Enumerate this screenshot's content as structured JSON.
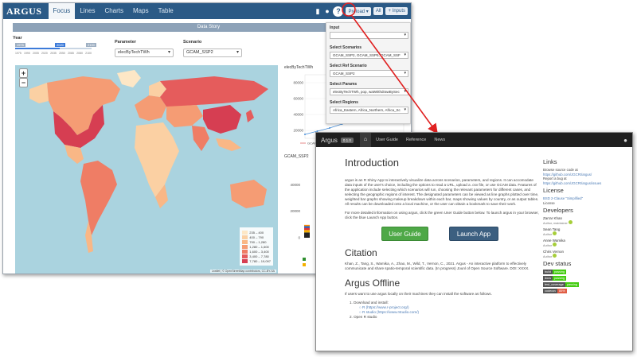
{
  "back_app": {
    "brand": "ARGUS",
    "tabs": [
      "Focus",
      "Lines",
      "Charts",
      "Maps",
      "Table"
    ],
    "active_tab": 0,
    "buttons": {
      "preload": "Preload ▾",
      "all": "All",
      "inputs": "+ Inputs"
    },
    "data_story": "Data Story",
    "year": {
      "label": "Year",
      "min": "1975",
      "current": "2020",
      "max": "2100",
      "ticks": [
        "1975",
        "1990",
        "2005",
        "2020",
        "2035",
        "2050",
        "2065",
        "2080",
        "2100"
      ]
    },
    "parameter": {
      "label": "Parameter",
      "value": "elecByTechTWh"
    },
    "scenario": {
      "label": "Scenario",
      "value": "GCAM_SSP2"
    },
    "map_legend": {
      "ranges": [
        "235 – 400",
        "400 – 790",
        "790 – 1,280",
        "1,280 – 1,600",
        "1,600 – 3,400",
        "3,400 – 7,780",
        "7,780 – 19,097"
      ],
      "colors": [
        "#fde7c6",
        "#fbd0a3",
        "#f9b786",
        "#f59c74",
        "#ef7d65",
        "#e55c5c",
        "#d63e52"
      ]
    },
    "map_attribution": "Leaflet | © OpenStreetMap contributors, CC-BY-SA",
    "zoom_in": "+",
    "zoom_out": "−",
    "line_chart_title": "elecByTechTWh",
    "bar_chart_title": "GCAM_SSP2",
    "legend_item": "GCAM",
    "input_panel": {
      "input_label": "Input",
      "scenarios_label": "Select Scenarios",
      "scenarios_value": "GCAM_SSP2, GCAM_SSP5, GCAM_SSF",
      "ref_label": "Select Ref Scenario",
      "ref_value": "GCAM_SSP2",
      "params_label": "Select Params",
      "params_value": "elecByTechTWh, pop, watWithdrawBySec",
      "regions_label": "Select Regions",
      "regions_value": "Africa_Eastern, Africa_Northern, Africa_Sc"
    }
  },
  "chart_data": [
    {
      "type": "line",
      "title": "elecByTechTWh",
      "y_ticks": [
        "80000",
        "60000",
        "40000",
        "20000"
      ],
      "ylim": [
        10000,
        90000
      ],
      "series": [
        {
          "name": "GCAM",
          "color": "#4a90d9",
          "x": [
            0,
            1,
            2,
            3,
            4,
            5,
            6,
            7,
            8
          ],
          "values": [
            15000,
            19000,
            23000,
            28000,
            33000,
            41000,
            49000,
            58000,
            66000
          ]
        },
        {
          "color": "#2f8f2f",
          "x": [
            4,
            5,
            6,
            7,
            8
          ],
          "values": [
            32000,
            38000,
            45000,
            53000,
            61000
          ]
        },
        {
          "color": "#e06b6b",
          "x": [
            5,
            6,
            7,
            8
          ],
          "values": [
            37000,
            43000,
            49000,
            55000
          ]
        }
      ]
    },
    {
      "type": "bar",
      "title": "GCAM_SSP2",
      "y_ticks": [
        "40000",
        "20000",
        "0"
      ],
      "ylim": [
        0,
        45000
      ],
      "categories": [
        "GCAM_SSP2"
      ],
      "stacks": [
        {
          "color": "#222222",
          "value": 4000
        },
        {
          "color": "#f4b000",
          "value": 1800
        },
        {
          "color": "#e03030",
          "value": 1600
        },
        {
          "color": "#1f5ab8",
          "value": 1400
        },
        {
          "color": "#ff8c00",
          "value": 900
        }
      ]
    }
  ],
  "front_app": {
    "brand": "Argus",
    "version": "0.1.0",
    "nav": [
      "User Guide",
      "Reference",
      "News"
    ],
    "title": "Introduction",
    "intro_text": "argus is an R Shiny App to interactively visualize data across scenarios, parameters, and regions. It can accomodate data inputs of the user's choice, including the options to read a URL, upload a .csv file, or use GCAM data. Features of the application include selecting which scenarios will run, choosing the relevant parameters for different cases, and selecting the geographic regions of interest. The designated parameters can be viewed as line graphs plotted over time, weighted bar graphs showing makeup breakdown within each bar, maps showing values by country, or as output tables. All results can be downloaded onto a local machine, or the user can obtain a bookmark to save their work.",
    "more_text": "For more detailed information on using argus, click the green User Guide button below. To launch argus in your browser, click the blue Launch App button.",
    "btn_guide": "User Guide",
    "btn_launch": "Launch App",
    "citation_title": "Citation",
    "citation_text": "Khan, Z., Tang, S., Wamika, A., Zhao, M., Wild, T., Vernon, C., 2021. Argus - An interactive platform to effectively communicate and share spatio-temporal scientific data. (In progress) Jounl of Open Source Software. DOI: XXXX.",
    "offline_title": "Argus Offline",
    "offline_text": "If users want to use argus locally on their machines they can install the software as follows.",
    "steps": [
      "1. Download and install:",
      "2. Open R studio"
    ],
    "substeps": [
      "○ R (https://www.r-project.org/)",
      "○ R studio (https://www.rstudio.com/)"
    ],
    "links_title": "Links",
    "links": [
      "Browse source code at",
      "https://github.com/JGCRI/argus/",
      "Report a bug at",
      "https://github.com/JGCRI/argus/issues"
    ],
    "license_title": "License",
    "license": [
      "BSD 2-Clause \"Simplified\"",
      "License"
    ],
    "developers_title": "Developers",
    "developers": [
      {
        "name": "Zarrar Khan",
        "role": "Author, maintainer"
      },
      {
        "name": "Sean Tang",
        "role": "Author"
      },
      {
        "name": "Anne Wamika",
        "role": "Author"
      },
      {
        "name": "Chris Vernon",
        "role": "Author"
      }
    ],
    "dev_status_title": "Dev status",
    "badges": [
      {
        "k": "build",
        "v": "passing",
        "color": "#44cc11"
      },
      {
        "k": "docs",
        "v": "passing",
        "color": "#44cc11"
      },
      {
        "k": "test_coverage",
        "v": "passing",
        "color": "#44cc11"
      },
      {
        "k": "codecov",
        "v": "85%",
        "color": "#e05d44"
      }
    ]
  }
}
